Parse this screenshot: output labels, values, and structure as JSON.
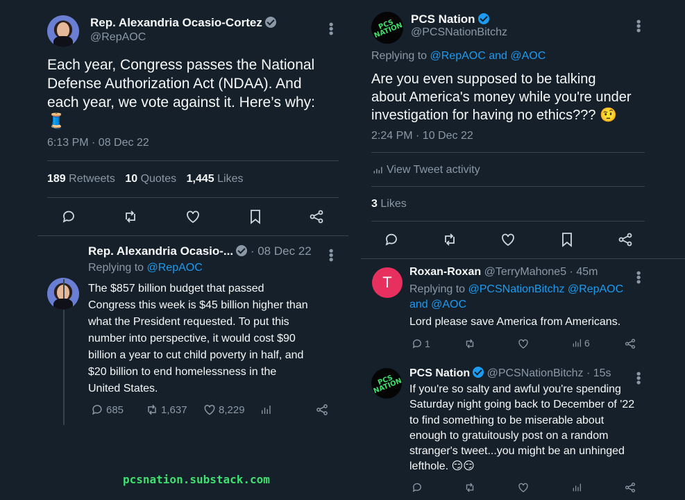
{
  "left": {
    "tweet": {
      "author": "Rep. Alexandria Ocasio-Cortez",
      "handle": "@RepAOC",
      "text_lines": [
        "Each year, Congress passes the National",
        "Defense Authorization Act (NDAA). And",
        "each year, we vote against it. Here’s why:",
        "🧵"
      ],
      "timestamp": "6:13 PM · 08 Dec 22",
      "stats": {
        "retweets_count": "189",
        "retweets_label": "Retweets",
        "quotes_count": "10",
        "quotes_label": "Quotes",
        "likes_count": "1,445",
        "likes_label": "Likes"
      }
    },
    "reply": {
      "author": "Rep. Alexandria Ocasio-...",
      "date": "· 08 Dec 22",
      "replying_prefix": "Replying to",
      "replying_to": "@RepAOC",
      "text_lines": [
        "The $857 billion budget that passed",
        "Congress this week is $45 billion higher than",
        "what the President requested. To put this",
        "number into perspective, it would cost $90",
        "billion a year to cut child poverty in half, and",
        "$20 billion to end homelessness in the",
        "United States."
      ],
      "replies": "685",
      "retweets": "1,637",
      "likes": "8,229"
    },
    "watermark": "pcsnation.substack.com"
  },
  "right": {
    "tweet": {
      "author": "PCS Nation",
      "handle": "@PCSNationBitchz",
      "avatar_text": "PCS NATION",
      "replying_prefix": "Replying to",
      "replying_to": "@RepAOC and @AOC",
      "text_lines": [
        "Are you even supposed to be talking",
        "about America's money while you're under",
        "investigation for having no ethics??? 🤨"
      ],
      "timestamp": "2:24 PM · 10 Dec 22",
      "view_activity": "View Tweet activity",
      "likes_count": "3",
      "likes_label": "Likes"
    },
    "reply1": {
      "avatar_letter": "T",
      "author": "Roxan-Roxan",
      "handle_time": "@TerryMahone5 · 45m",
      "replying_prefix": "Replying to",
      "replying_line1": "@PCSNationBitchz @RepAOC",
      "replying_line2": "and @AOC",
      "text": "Lord please save America from Americans.",
      "replies": "1",
      "views": "6"
    },
    "reply2": {
      "author": "PCS Nation",
      "handle_time": "@PCSNationBitchz · 15s",
      "text_lines": [
        "If you're so salty and awful you're spending",
        "Saturday night going back to December of '22",
        "to find something to be miserable about",
        "enough to gratuitously post on a random",
        "stranger's tweet...you might be an unhinged",
        "lefthole. 😏😏"
      ]
    }
  },
  "colors": {
    "background": "#15202b",
    "accent": "#1d9bf0",
    "muted": "#8b98a5",
    "watermark": "#3fe06f"
  }
}
